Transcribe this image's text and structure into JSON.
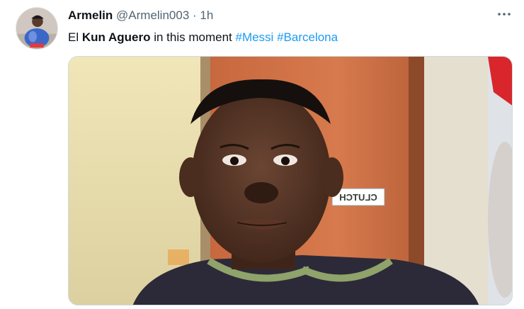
{
  "author": {
    "name": "Armelin",
    "handle": "@Armelin003",
    "separator": "·",
    "time": "1h"
  },
  "tweet": {
    "parts": {
      "p1": "El ",
      "p2": "Kun Aguero",
      "p3": " in this moment ",
      "hashtag1": "#Messi",
      "space": " ",
      "hashtag2": "#Barcelona"
    }
  },
  "media": {
    "sign_text": "CLUTCH"
  },
  "colors": {
    "hashtag": "#1d9bf0",
    "name": "#0f1419",
    "secondary": "#536471"
  },
  "icons": {
    "more": "more-horizontal-icon"
  }
}
